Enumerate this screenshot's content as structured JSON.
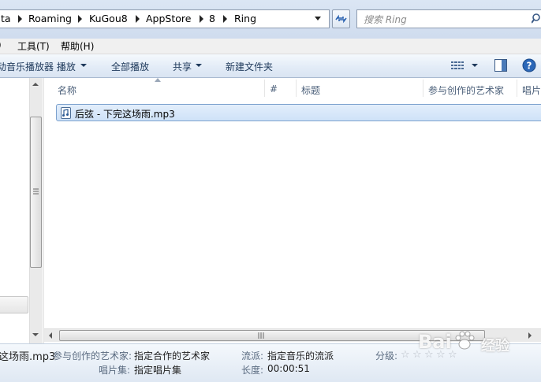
{
  "address_bar": {
    "crumbs": [
      "ta",
      "Roaming",
      "KuGou8",
      "AppStore",
      "8",
      "Ring"
    ]
  },
  "search": {
    "placeholder": "搜索 Ring"
  },
  "menu": {
    "items": [
      "工具(T)",
      "帮助(H)"
    ]
  },
  "command_bar": {
    "open_with": "动音乐播放器 播放",
    "play_all": "全部播放",
    "share": "共享",
    "new_folder": "新建文件夹"
  },
  "columns": [
    "名称",
    "#",
    "标题",
    "参与创作的艺术家",
    "唱片"
  ],
  "files": [
    {
      "name": "后弦 - 下完这场雨.mp3"
    }
  ],
  "details": {
    "file_name": "这场雨.mp3",
    "artist_label": "参与创作的艺术家:",
    "artist_value": "指定合作的艺术家",
    "album_label": "唱片集:",
    "album_value": "指定唱片集",
    "genre_label": "流派:",
    "genre_value": "指定音乐的流派",
    "length_label": "长度:",
    "length_value": "00:00:51",
    "rating_label": "分级:",
    "rating_value": 0
  },
  "watermark": {
    "brand": "Bai",
    "suffix": "经验"
  },
  "colors": {
    "accent": "#1e395b",
    "selection_border": "#7da2ce",
    "selection_fill": "#cfe2f8"
  }
}
